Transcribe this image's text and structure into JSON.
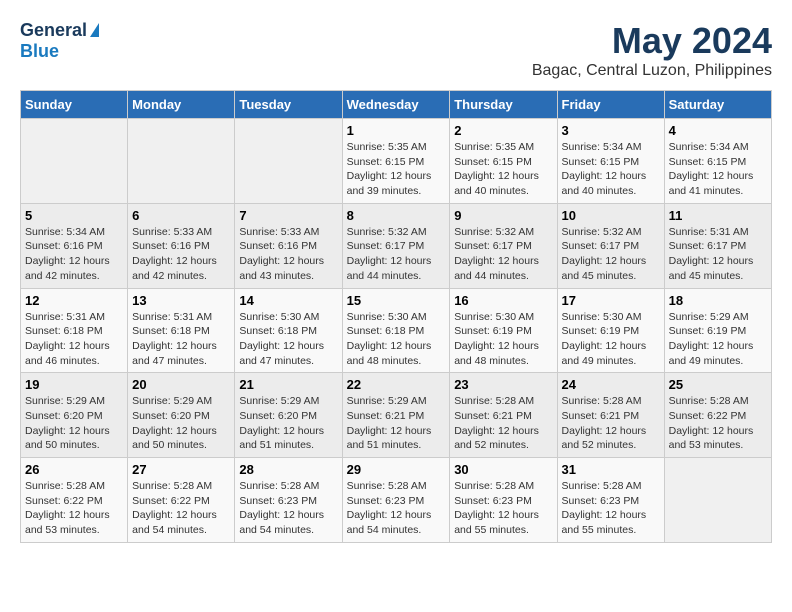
{
  "header": {
    "logo_general": "General",
    "logo_blue": "Blue",
    "month_year": "May 2024",
    "location": "Bagac, Central Luzon, Philippines"
  },
  "columns": [
    "Sunday",
    "Monday",
    "Tuesday",
    "Wednesday",
    "Thursday",
    "Friday",
    "Saturday"
  ],
  "weeks": [
    [
      {
        "day": "",
        "sunrise": "",
        "sunset": "",
        "daylight": ""
      },
      {
        "day": "",
        "sunrise": "",
        "sunset": "",
        "daylight": ""
      },
      {
        "day": "",
        "sunrise": "",
        "sunset": "",
        "daylight": ""
      },
      {
        "day": "1",
        "sunrise": "Sunrise: 5:35 AM",
        "sunset": "Sunset: 6:15 PM",
        "daylight": "Daylight: 12 hours and 39 minutes."
      },
      {
        "day": "2",
        "sunrise": "Sunrise: 5:35 AM",
        "sunset": "Sunset: 6:15 PM",
        "daylight": "Daylight: 12 hours and 40 minutes."
      },
      {
        "day": "3",
        "sunrise": "Sunrise: 5:34 AM",
        "sunset": "Sunset: 6:15 PM",
        "daylight": "Daylight: 12 hours and 40 minutes."
      },
      {
        "day": "4",
        "sunrise": "Sunrise: 5:34 AM",
        "sunset": "Sunset: 6:15 PM",
        "daylight": "Daylight: 12 hours and 41 minutes."
      }
    ],
    [
      {
        "day": "5",
        "sunrise": "Sunrise: 5:34 AM",
        "sunset": "Sunset: 6:16 PM",
        "daylight": "Daylight: 12 hours and 42 minutes."
      },
      {
        "day": "6",
        "sunrise": "Sunrise: 5:33 AM",
        "sunset": "Sunset: 6:16 PM",
        "daylight": "Daylight: 12 hours and 42 minutes."
      },
      {
        "day": "7",
        "sunrise": "Sunrise: 5:33 AM",
        "sunset": "Sunset: 6:16 PM",
        "daylight": "Daylight: 12 hours and 43 minutes."
      },
      {
        "day": "8",
        "sunrise": "Sunrise: 5:32 AM",
        "sunset": "Sunset: 6:17 PM",
        "daylight": "Daylight: 12 hours and 44 minutes."
      },
      {
        "day": "9",
        "sunrise": "Sunrise: 5:32 AM",
        "sunset": "Sunset: 6:17 PM",
        "daylight": "Daylight: 12 hours and 44 minutes."
      },
      {
        "day": "10",
        "sunrise": "Sunrise: 5:32 AM",
        "sunset": "Sunset: 6:17 PM",
        "daylight": "Daylight: 12 hours and 45 minutes."
      },
      {
        "day": "11",
        "sunrise": "Sunrise: 5:31 AM",
        "sunset": "Sunset: 6:17 PM",
        "daylight": "Daylight: 12 hours and 45 minutes."
      }
    ],
    [
      {
        "day": "12",
        "sunrise": "Sunrise: 5:31 AM",
        "sunset": "Sunset: 6:18 PM",
        "daylight": "Daylight: 12 hours and 46 minutes."
      },
      {
        "day": "13",
        "sunrise": "Sunrise: 5:31 AM",
        "sunset": "Sunset: 6:18 PM",
        "daylight": "Daylight: 12 hours and 47 minutes."
      },
      {
        "day": "14",
        "sunrise": "Sunrise: 5:30 AM",
        "sunset": "Sunset: 6:18 PM",
        "daylight": "Daylight: 12 hours and 47 minutes."
      },
      {
        "day": "15",
        "sunrise": "Sunrise: 5:30 AM",
        "sunset": "Sunset: 6:18 PM",
        "daylight": "Daylight: 12 hours and 48 minutes."
      },
      {
        "day": "16",
        "sunrise": "Sunrise: 5:30 AM",
        "sunset": "Sunset: 6:19 PM",
        "daylight": "Daylight: 12 hours and 48 minutes."
      },
      {
        "day": "17",
        "sunrise": "Sunrise: 5:30 AM",
        "sunset": "Sunset: 6:19 PM",
        "daylight": "Daylight: 12 hours and 49 minutes."
      },
      {
        "day": "18",
        "sunrise": "Sunrise: 5:29 AM",
        "sunset": "Sunset: 6:19 PM",
        "daylight": "Daylight: 12 hours and 49 minutes."
      }
    ],
    [
      {
        "day": "19",
        "sunrise": "Sunrise: 5:29 AM",
        "sunset": "Sunset: 6:20 PM",
        "daylight": "Daylight: 12 hours and 50 minutes."
      },
      {
        "day": "20",
        "sunrise": "Sunrise: 5:29 AM",
        "sunset": "Sunset: 6:20 PM",
        "daylight": "Daylight: 12 hours and 50 minutes."
      },
      {
        "day": "21",
        "sunrise": "Sunrise: 5:29 AM",
        "sunset": "Sunset: 6:20 PM",
        "daylight": "Daylight: 12 hours and 51 minutes."
      },
      {
        "day": "22",
        "sunrise": "Sunrise: 5:29 AM",
        "sunset": "Sunset: 6:21 PM",
        "daylight": "Daylight: 12 hours and 51 minutes."
      },
      {
        "day": "23",
        "sunrise": "Sunrise: 5:28 AM",
        "sunset": "Sunset: 6:21 PM",
        "daylight": "Daylight: 12 hours and 52 minutes."
      },
      {
        "day": "24",
        "sunrise": "Sunrise: 5:28 AM",
        "sunset": "Sunset: 6:21 PM",
        "daylight": "Daylight: 12 hours and 52 minutes."
      },
      {
        "day": "25",
        "sunrise": "Sunrise: 5:28 AM",
        "sunset": "Sunset: 6:22 PM",
        "daylight": "Daylight: 12 hours and 53 minutes."
      }
    ],
    [
      {
        "day": "26",
        "sunrise": "Sunrise: 5:28 AM",
        "sunset": "Sunset: 6:22 PM",
        "daylight": "Daylight: 12 hours and 53 minutes."
      },
      {
        "day": "27",
        "sunrise": "Sunrise: 5:28 AM",
        "sunset": "Sunset: 6:22 PM",
        "daylight": "Daylight: 12 hours and 54 minutes."
      },
      {
        "day": "28",
        "sunrise": "Sunrise: 5:28 AM",
        "sunset": "Sunset: 6:23 PM",
        "daylight": "Daylight: 12 hours and 54 minutes."
      },
      {
        "day": "29",
        "sunrise": "Sunrise: 5:28 AM",
        "sunset": "Sunset: 6:23 PM",
        "daylight": "Daylight: 12 hours and 54 minutes."
      },
      {
        "day": "30",
        "sunrise": "Sunrise: 5:28 AM",
        "sunset": "Sunset: 6:23 PM",
        "daylight": "Daylight: 12 hours and 55 minutes."
      },
      {
        "day": "31",
        "sunrise": "Sunrise: 5:28 AM",
        "sunset": "Sunset: 6:23 PM",
        "daylight": "Daylight: 12 hours and 55 minutes."
      },
      {
        "day": "",
        "sunrise": "",
        "sunset": "",
        "daylight": ""
      }
    ]
  ]
}
